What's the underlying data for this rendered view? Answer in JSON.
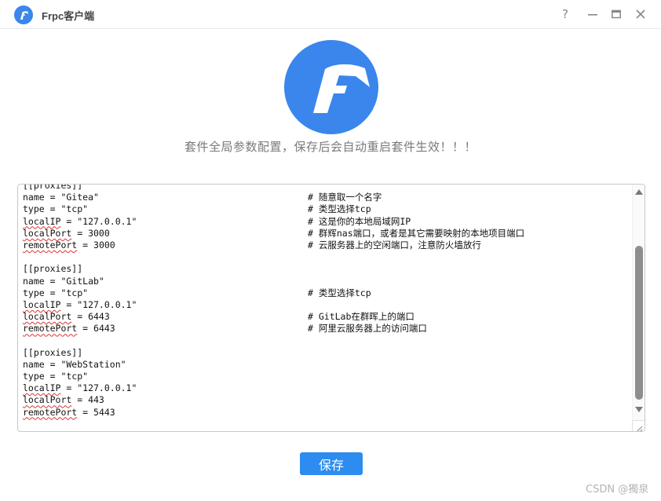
{
  "window": {
    "title": "Frpc客户端",
    "controls": {
      "help": "?",
      "minimize": "—",
      "maximize": "▬",
      "close": "✕"
    }
  },
  "brand": {
    "accent": "#2d8cf0",
    "logo_color": "#3a86ec",
    "logo_letter": "F"
  },
  "subtitle": "套件全局参数配置，保存后会自动重启套件生效！！！",
  "editor": {
    "lines": [
      {
        "code": "[[proxies]]",
        "comment": ""
      },
      {
        "code": "name = \"Gitea\"",
        "comment": "# 随意取一个名字"
      },
      {
        "code": "type = \"tcp\"",
        "comment": "# 类型选择tcp"
      },
      {
        "code": "localIP = \"127.0.0.1\"",
        "comment": "# 这是你的本地局域网IP"
      },
      {
        "code": "localPort = 3000",
        "comment": "# 群辉nas端口，或者是其它需要映射的本地项目端口"
      },
      {
        "code": "remotePort = 3000",
        "comment": "# 云服务器上的空闲端口，注意防火墙放行"
      },
      {
        "code": "",
        "comment": ""
      },
      {
        "code": "[[proxies]]",
        "comment": ""
      },
      {
        "code": "name = \"GitLab\"",
        "comment": ""
      },
      {
        "code": "type = \"tcp\"",
        "comment": "# 类型选择tcp"
      },
      {
        "code": "localIP = \"127.0.0.1\"",
        "comment": ""
      },
      {
        "code": "localPort = 6443",
        "comment": "# GitLab在群晖上的端口"
      },
      {
        "code": "remotePort = 6443",
        "comment": "# 阿里云服务器上的访问端口"
      },
      {
        "code": "",
        "comment": ""
      },
      {
        "code": "[[proxies]]",
        "comment": ""
      },
      {
        "code": "name = \"WebStation\"",
        "comment": ""
      },
      {
        "code": "type = \"tcp\"",
        "comment": ""
      },
      {
        "code": "localIP = \"127.0.0.1\"",
        "comment": ""
      },
      {
        "code": "localPort = 443",
        "comment": ""
      },
      {
        "code": "remotePort = 5443",
        "comment": ""
      }
    ]
  },
  "actions": {
    "save_label": "保存"
  },
  "watermark": "CSDN @獨泉"
}
